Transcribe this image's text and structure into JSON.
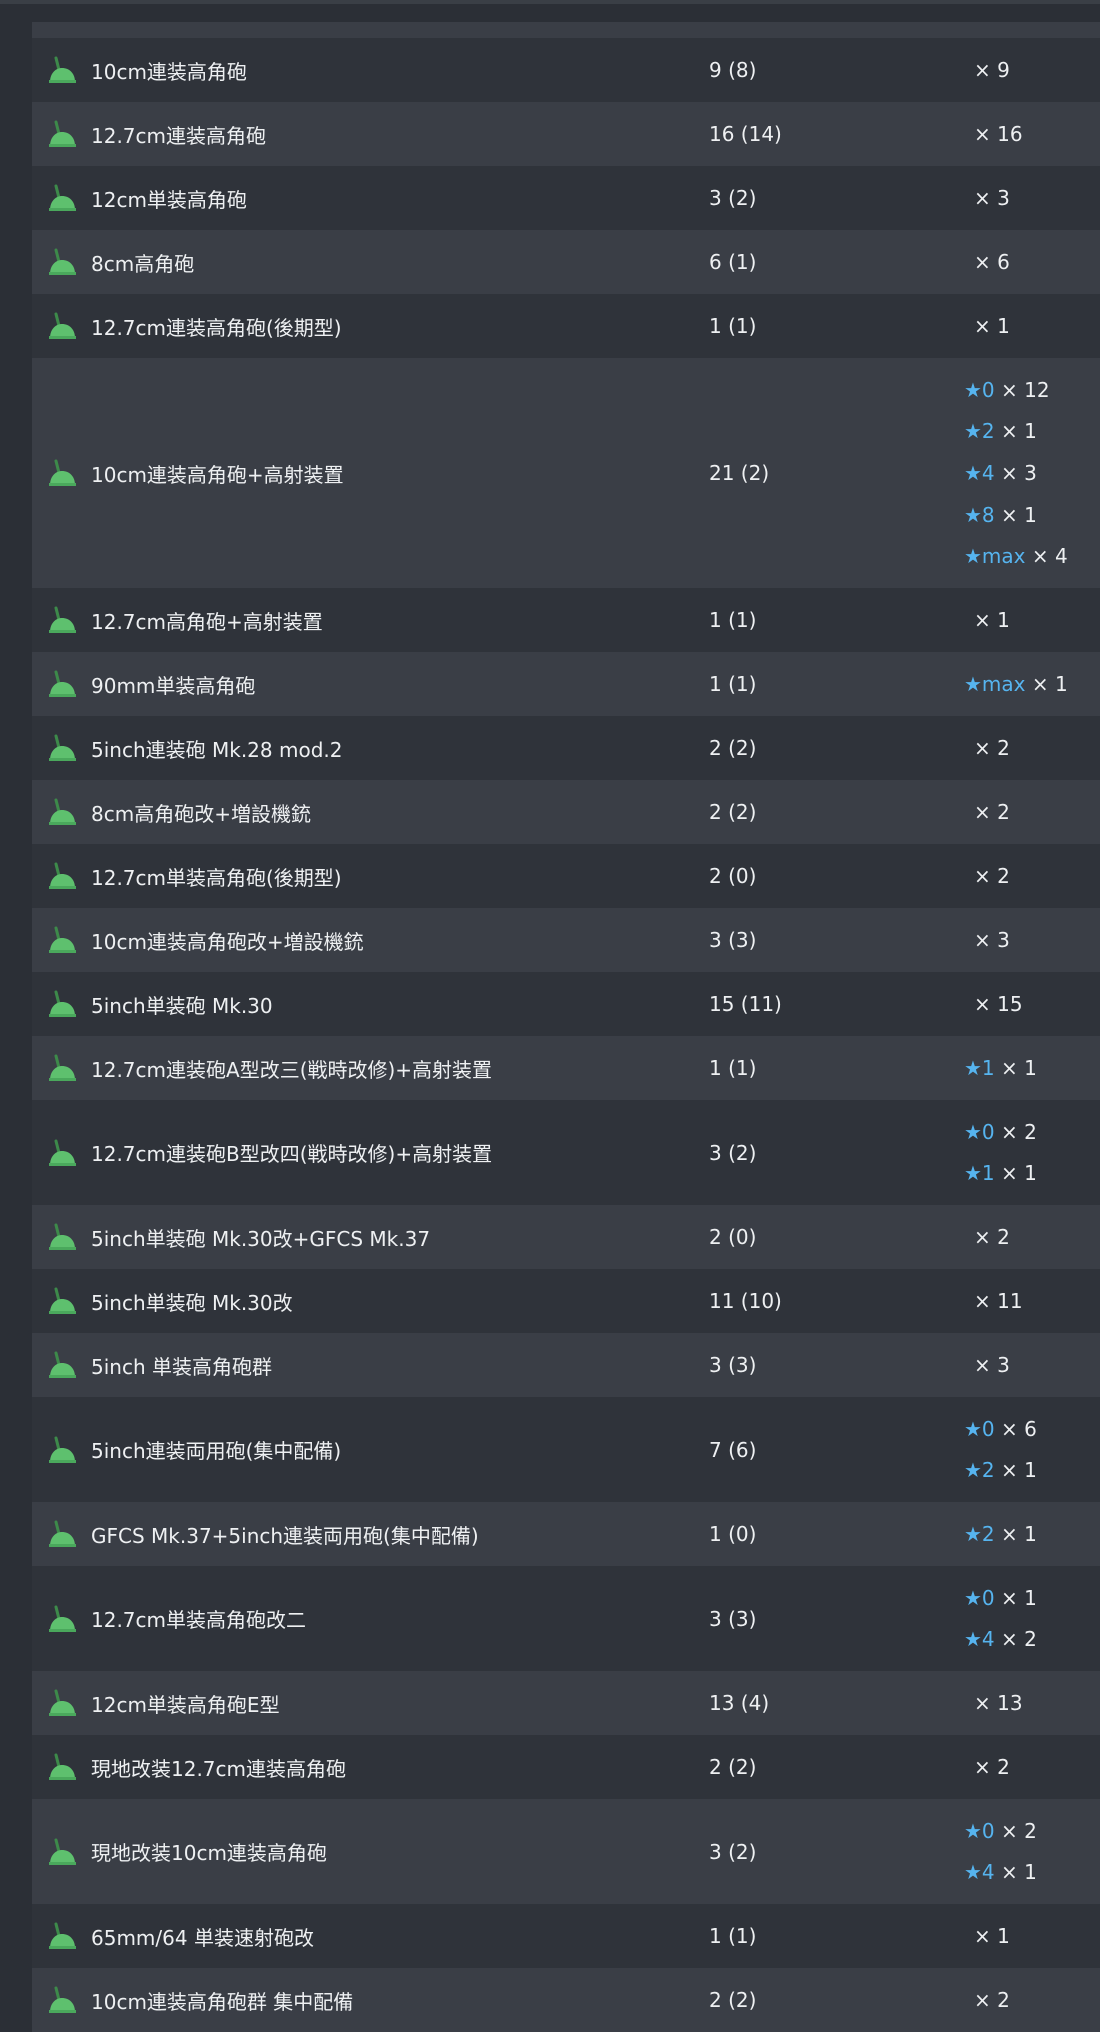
{
  "colors": {
    "background": "#2b2f36",
    "row_dark": "#2f333a",
    "row_light": "#3a3e46",
    "star": "#56b4ef",
    "icon_green": "#5ec06e",
    "icon_barrel": "#3d8a4a"
  },
  "icon_name": "aa-gun-icon",
  "rows": [
    {
      "name": "10cm連装高角砲",
      "count": "9 (8)",
      "levels": [
        {
          "star": "",
          "qty": "× 9"
        }
      ]
    },
    {
      "name": "12.7cm連装高角砲",
      "count": "16 (14)",
      "levels": [
        {
          "star": "",
          "qty": "× 16"
        }
      ]
    },
    {
      "name": "12cm単装高角砲",
      "count": "3 (2)",
      "levels": [
        {
          "star": "",
          "qty": "× 3"
        }
      ]
    },
    {
      "name": "8cm高角砲",
      "count": "6 (1)",
      "levels": [
        {
          "star": "",
          "qty": "× 6"
        }
      ]
    },
    {
      "name": "12.7cm連装高角砲(後期型)",
      "count": "1 (1)",
      "levels": [
        {
          "star": "",
          "qty": "× 1"
        }
      ]
    },
    {
      "name": "10cm連装高角砲+高射装置",
      "count": "21 (2)",
      "levels": [
        {
          "star": "★0",
          "qty": "× 12"
        },
        {
          "star": "★2",
          "qty": "× 1"
        },
        {
          "star": "★4",
          "qty": "× 3"
        },
        {
          "star": "★8",
          "qty": "× 1"
        },
        {
          "star": "★max",
          "qty": "× 4"
        }
      ]
    },
    {
      "name": "12.7cm高角砲+高射装置",
      "count": "1 (1)",
      "levels": [
        {
          "star": "",
          "qty": "× 1"
        }
      ]
    },
    {
      "name": "90mm単装高角砲",
      "count": "1 (1)",
      "levels": [
        {
          "star": "★max",
          "qty": "× 1"
        }
      ]
    },
    {
      "name": "5inch連装砲 Mk.28 mod.2",
      "count": "2 (2)",
      "levels": [
        {
          "star": "",
          "qty": "× 2"
        }
      ]
    },
    {
      "name": "8cm高角砲改+増設機銃",
      "count": "2 (2)",
      "levels": [
        {
          "star": "",
          "qty": "× 2"
        }
      ]
    },
    {
      "name": "12.7cm単装高角砲(後期型)",
      "count": "2 (0)",
      "levels": [
        {
          "star": "",
          "qty": "× 2"
        }
      ]
    },
    {
      "name": "10cm連装高角砲改+増設機銃",
      "count": "3 (3)",
      "levels": [
        {
          "star": "",
          "qty": "× 3"
        }
      ]
    },
    {
      "name": "5inch単装砲 Mk.30",
      "count": "15 (11)",
      "levels": [
        {
          "star": "",
          "qty": "× 15"
        }
      ]
    },
    {
      "name": "12.7cm連装砲A型改三(戦時改修)+高射装置",
      "count": "1 (1)",
      "levels": [
        {
          "star": "★1",
          "qty": "× 1"
        }
      ]
    },
    {
      "name": "12.7cm連装砲B型改四(戦時改修)+高射装置",
      "count": "3 (2)",
      "levels": [
        {
          "star": "★0",
          "qty": "× 2"
        },
        {
          "star": "★1",
          "qty": "× 1"
        }
      ]
    },
    {
      "name": "5inch単装砲 Mk.30改+GFCS Mk.37",
      "count": "2 (0)",
      "levels": [
        {
          "star": "",
          "qty": "× 2"
        }
      ]
    },
    {
      "name": "5inch単装砲 Mk.30改",
      "count": "11 (10)",
      "levels": [
        {
          "star": "",
          "qty": "× 11"
        }
      ]
    },
    {
      "name": "5inch 単装高角砲群",
      "count": "3 (3)",
      "levels": [
        {
          "star": "",
          "qty": "× 3"
        }
      ]
    },
    {
      "name": "5inch連装両用砲(集中配備)",
      "count": "7 (6)",
      "levels": [
        {
          "star": "★0",
          "qty": "× 6"
        },
        {
          "star": "★2",
          "qty": "× 1"
        }
      ]
    },
    {
      "name": "GFCS Mk.37+5inch連装両用砲(集中配備)",
      "count": "1 (0)",
      "levels": [
        {
          "star": "★2",
          "qty": "× 1"
        }
      ]
    },
    {
      "name": "12.7cm単装高角砲改二",
      "count": "3 (3)",
      "levels": [
        {
          "star": "★0",
          "qty": "× 1"
        },
        {
          "star": "★4",
          "qty": "× 2"
        }
      ]
    },
    {
      "name": "12cm単装高角砲E型",
      "count": "13 (4)",
      "levels": [
        {
          "star": "",
          "qty": "× 13"
        }
      ]
    },
    {
      "name": "現地改装12.7cm連装高角砲",
      "count": "2 (2)",
      "levels": [
        {
          "star": "",
          "qty": "× 2"
        }
      ]
    },
    {
      "name": "現地改装10cm連装高角砲",
      "count": "3 (2)",
      "levels": [
        {
          "star": "★0",
          "qty": "× 2"
        },
        {
          "star": "★4",
          "qty": "× 1"
        }
      ]
    },
    {
      "name": "65mm/64 単装速射砲改",
      "count": "1 (1)",
      "levels": [
        {
          "star": "",
          "qty": "× 1"
        }
      ]
    },
    {
      "name": "10cm連装高角砲群 集中配備",
      "count": "2 (2)",
      "levels": [
        {
          "star": "",
          "qty": "× 2"
        }
      ]
    }
  ]
}
